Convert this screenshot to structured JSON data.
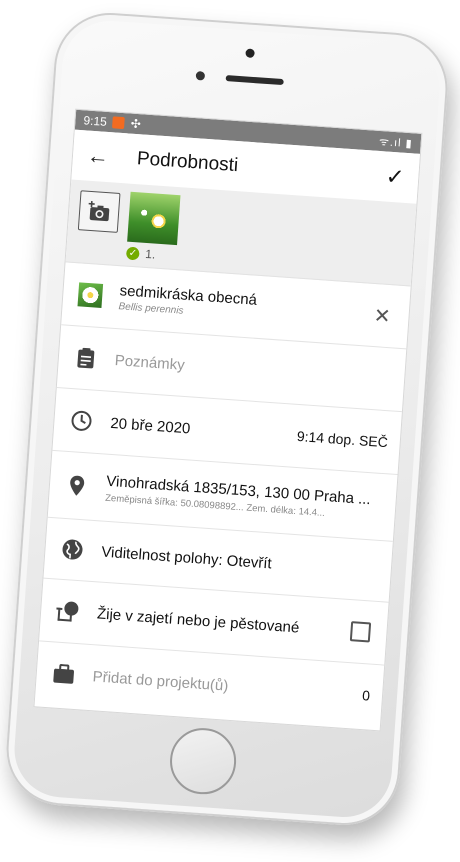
{
  "status": {
    "time": "9:15",
    "icons": "ᯤ.ıl ▮"
  },
  "appbar": {
    "title": "Podrobnosti"
  },
  "photos": {
    "count_label": "1."
  },
  "species": {
    "common": "sedmikráska obecná",
    "latin": "Bellis perennis"
  },
  "notes": {
    "placeholder": "Poznámky"
  },
  "datetime": {
    "date": "20 bře 2020",
    "time": "9:14 dop. SEČ"
  },
  "location": {
    "address": "Vinohradská 1835/153, 130 00 Praha ...",
    "coords": "Zeměpisná šířka: 50.08098892...  Zem. délka: 14.4..."
  },
  "visibility": {
    "label": "Viditelnost polohy: Otevřít"
  },
  "captive": {
    "label": "Žije v zajetí nebo je pěstované"
  },
  "project": {
    "label": "Přidat do projektu(ů)",
    "count": "0"
  },
  "colors": {
    "accent": "#74ac00",
    "statusbar": "#7c7c7c",
    "notification": "#f26b21"
  }
}
